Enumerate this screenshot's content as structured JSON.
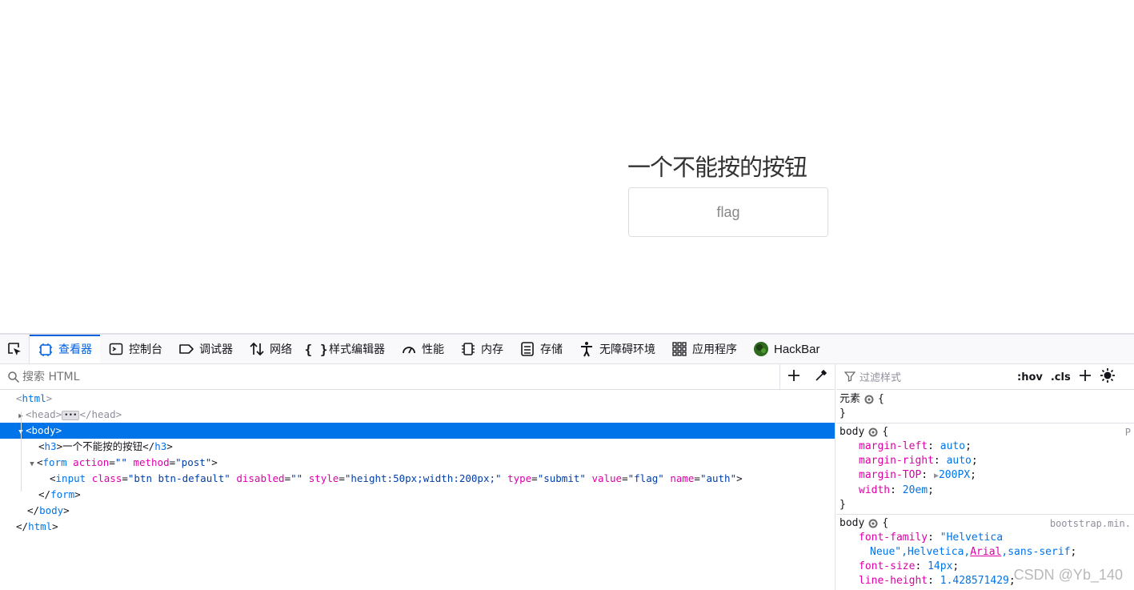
{
  "page": {
    "heading": "一个不能按的按钮",
    "button_label": "flag"
  },
  "devtools": {
    "tabs": [
      {
        "label": "查看器",
        "icon": "inspector-icon"
      },
      {
        "label": "控制台",
        "icon": "console-icon"
      },
      {
        "label": "调试器",
        "icon": "debugger-icon"
      },
      {
        "label": "网络",
        "icon": "network-icon"
      },
      {
        "label": "样式编辑器",
        "icon": "style-editor-icon"
      },
      {
        "label": "性能",
        "icon": "performance-icon"
      },
      {
        "label": "内存",
        "icon": "memory-icon"
      },
      {
        "label": "存储",
        "icon": "storage-icon"
      },
      {
        "label": "无障碍环境",
        "icon": "accessibility-icon"
      },
      {
        "label": "应用程序",
        "icon": "application-icon"
      },
      {
        "label": "HackBar",
        "icon": "hackbar-icon"
      }
    ],
    "active_tab": "查看器",
    "markup_search_placeholder": "搜索 HTML",
    "rules_filter_placeholder": "过滤样式",
    "rules_toggles": {
      "hov": ":hov",
      "cls": ".cls"
    },
    "tree": {
      "html_open": "html",
      "head": "head",
      "body": "body",
      "h3_text": "一个不能按的按钮",
      "h3": "h3",
      "form": "form",
      "form_attrs": [
        {
          "name": "action",
          "value": "\"\""
        },
        {
          "name": "method",
          "value": "\"post\""
        }
      ],
      "input": "input",
      "input_attrs": [
        {
          "name": "class",
          "value": "\"btn btn-default\""
        },
        {
          "name": "disabled",
          "value": "\"\""
        },
        {
          "name": "style",
          "value": "\"height:50px;width:200px;\""
        },
        {
          "name": "type",
          "value": "\"submit\""
        },
        {
          "name": "value",
          "value": "\"flag\""
        },
        {
          "name": "name",
          "value": "\"auth\""
        }
      ]
    },
    "rules": {
      "element_selector": "元素",
      "rule1": {
        "selector": "body",
        "source": "P",
        "decls": [
          {
            "prop": "margin-left",
            "val": "auto"
          },
          {
            "prop": "margin-right",
            "val": "auto"
          },
          {
            "prop": "margin-TOP",
            "val": "200PX"
          },
          {
            "prop": "width",
            "val": "20em"
          }
        ]
      },
      "rule2": {
        "selector": "body",
        "source": "bootstrap.min.",
        "font_family_prop": "font-family",
        "font_family_val1": "\"Helvetica",
        "font_family_val2a": "Neue\",Helvetica,",
        "font_family_val2b": "Arial",
        "font_family_val2c": ",sans-serif",
        "font_size_prop": "font-size",
        "font_size_val": "14px",
        "line_height_prop": "line-height",
        "line_height_val": "1.428571429"
      }
    }
  },
  "watermark": "CSDN @Yb_140"
}
